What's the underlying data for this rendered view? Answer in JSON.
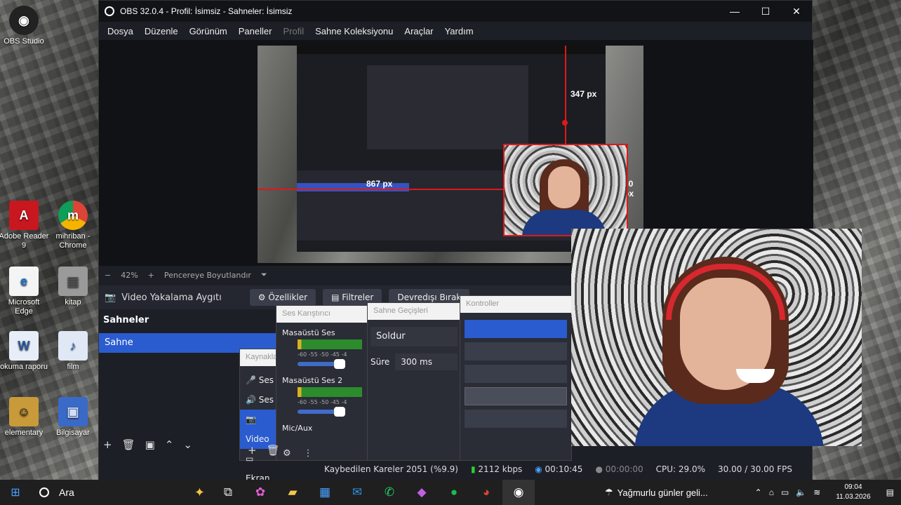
{
  "desktop": {
    "icons": [
      {
        "label": "OBS Studio",
        "glyph": "◉"
      },
      {
        "label": "Adobe Reader 9",
        "glyph": "A"
      },
      {
        "label": "mihriban - Chrome",
        "glyph": "m"
      },
      {
        "label": "Microsoft Edge",
        "glyph": "e"
      },
      {
        "label": "kitap",
        "glyph": "▤"
      },
      {
        "label": "okuma raporu",
        "glyph": "W"
      },
      {
        "label": "film",
        "glyph": "♪"
      },
      {
        "label": "elementary",
        "glyph": "☺"
      },
      {
        "label": "Bilgisayar",
        "glyph": "▣"
      }
    ]
  },
  "obs": {
    "title": "OBS 32.0.4 - Profil: İsimsiz - Sahneler: İsimsiz",
    "window_controls": {
      "minimize": "—",
      "maximize": "☐",
      "close": "✕"
    },
    "menu": [
      "Dosya",
      "Düzenle",
      "Görünüm",
      "Paneller",
      "Profil",
      "Sahne Koleksiyonu",
      "Araçlar",
      "Yardım"
    ],
    "preview": {
      "label_top": "347 px",
      "label_left": "867 px",
      "label_right": "60 px"
    },
    "zoom": {
      "minus": "−",
      "value": "42%",
      "plus": "+",
      "fit": "Pencereye Boyutlandır",
      "dropdown": "⏷"
    },
    "source_bar": {
      "source_name": "Video Yakalama Aygıtı",
      "properties": "Özellikler",
      "filters": "Filtreler",
      "deactivate": "Devredışı Bırak"
    },
    "scenes": {
      "header": "Sahneler",
      "items": [
        "Sahne"
      ]
    },
    "sources": {
      "header": "Kaynaklar",
      "items": [
        "Ses",
        "Ses",
        "Video",
        "Ekran"
      ]
    },
    "mixer": {
      "header": "Ses Karıştırıcı",
      "ticks": "-60 -55 -50 -45 -4",
      "channels": [
        "Masaüstü Ses",
        "Masaüstü Ses 2",
        "Mic/Aux"
      ]
    },
    "transitions": {
      "header": "Sahne Geçişleri",
      "type": "Soldur",
      "duration_label": "Süre",
      "duration": "300 ms"
    },
    "controls": {
      "header": "Kontroller"
    },
    "status": {
      "dropped": "Kaybedilen Kareler 2051 (%9.9)",
      "bitrate": "2112 kbps",
      "live_time": "00:10:45",
      "rec_time": "00:00:00",
      "cpu": "CPU: 29.0%",
      "fps": "30.00 / 30.00 FPS"
    }
  },
  "taskbar": {
    "search_label": "Ara",
    "weather": "Yağmurlu günler geli...",
    "time": "09:04",
    "date": "11.03.2026"
  }
}
